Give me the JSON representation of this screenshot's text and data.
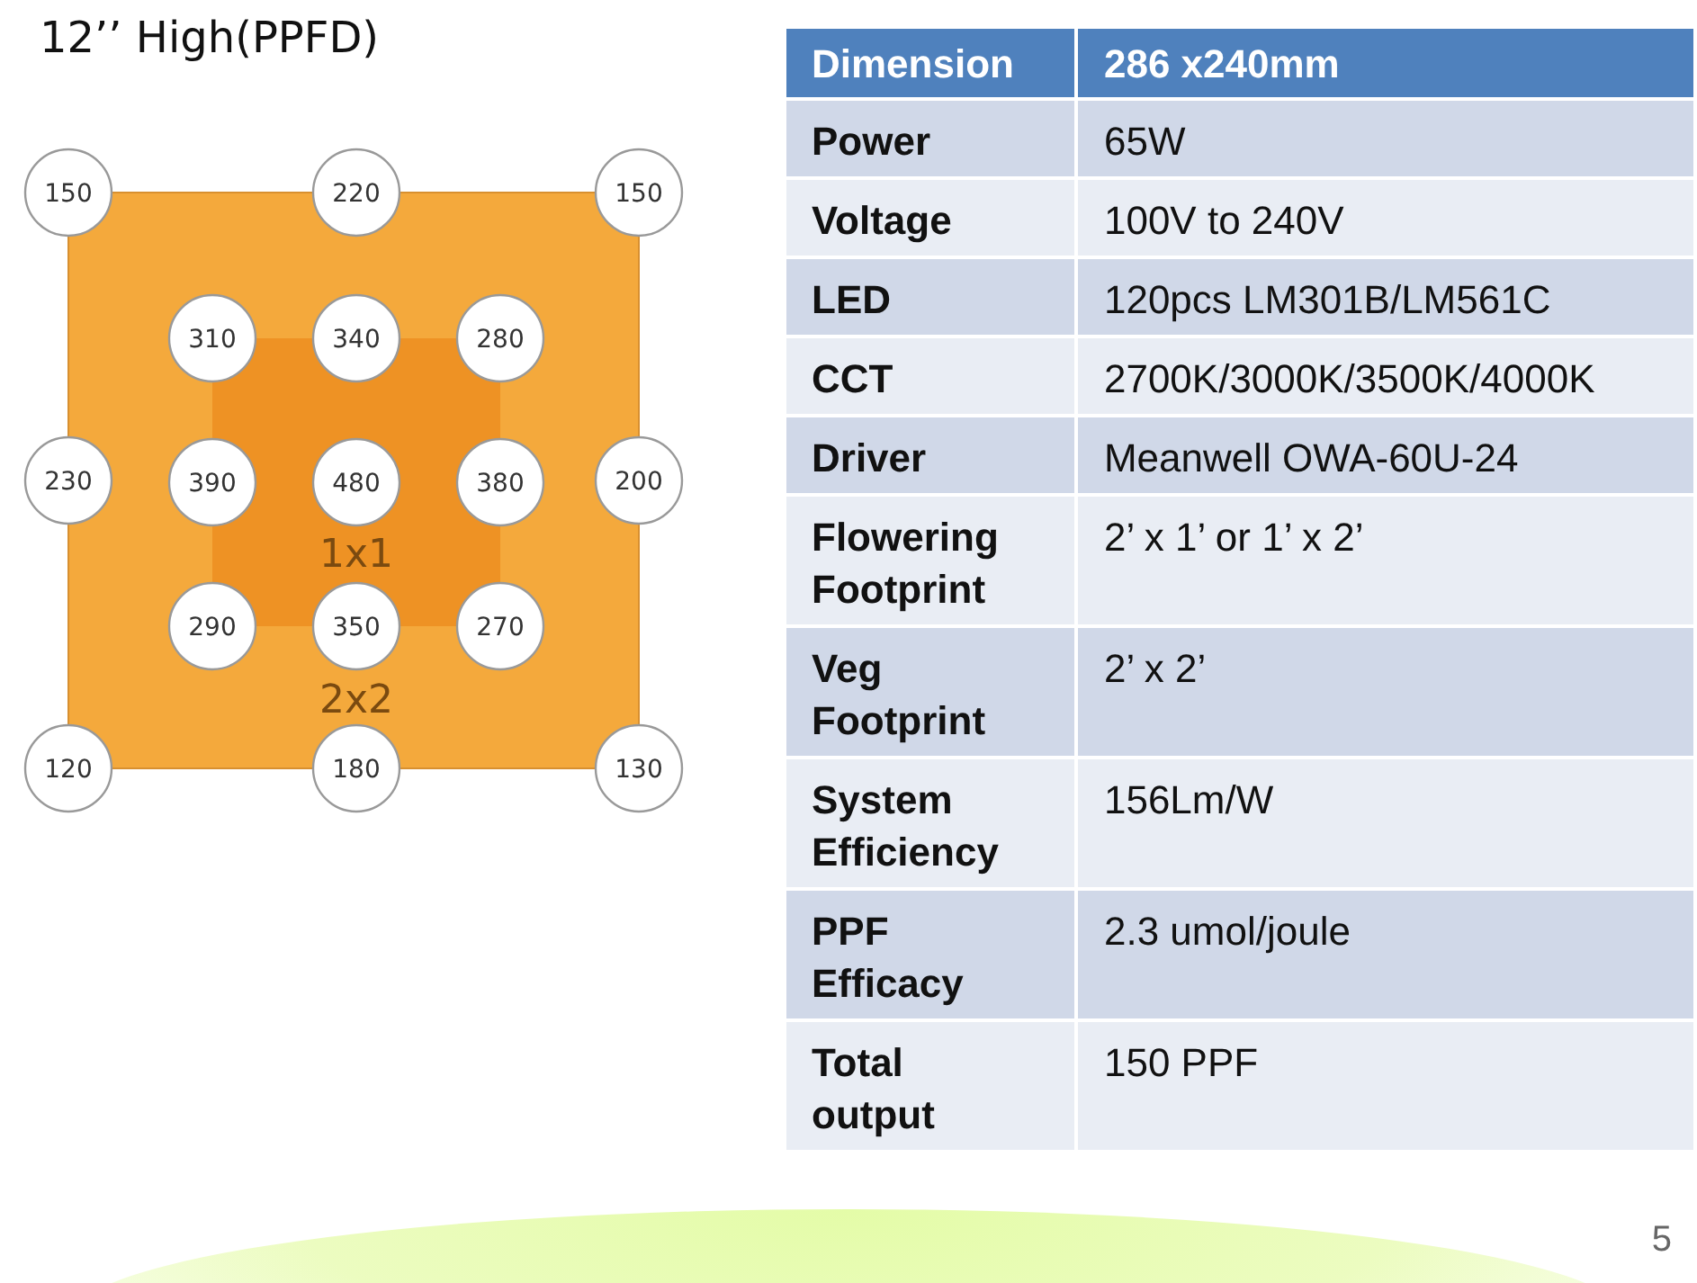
{
  "title": "12’’ High(PPFD)",
  "ppfd_map": {
    "outer_points": [
      [
        "150",
        "220",
        "150"
      ],
      [
        "230",
        "200"
      ],
      [
        "120",
        "180",
        "130"
      ]
    ],
    "inner_points": [
      [
        "310",
        "340",
        "280"
      ],
      [
        "390",
        "480",
        "380"
      ],
      [
        "290",
        "350",
        "270"
      ]
    ],
    "inner_area_label": "1x1",
    "outer_area_label": "2x2"
  },
  "spec_table": {
    "header": [
      "Dimension",
      "286 x240mm"
    ],
    "rows": [
      [
        "Power",
        "65W"
      ],
      [
        "Voltage",
        "100V to 240V"
      ],
      [
        "LED",
        "120pcs LM301B/LM561C"
      ],
      [
        "CCT",
        "2700K/3000K/3500K/4000K"
      ],
      [
        "Driver",
        "Meanwell OWA-60U-24"
      ],
      [
        "Flowering Footprint",
        "2’ x 1’ or 1’ x 2’"
      ],
      [
        "Veg Footprint",
        "2’ x 2’"
      ],
      [
        "System Efficiency",
        "156Lm/W"
      ],
      [
        "PPF Efficacy",
        "2.3 umol/joule"
      ],
      [
        "Total output",
        "150 PPF"
      ]
    ]
  },
  "page_number": "5"
}
